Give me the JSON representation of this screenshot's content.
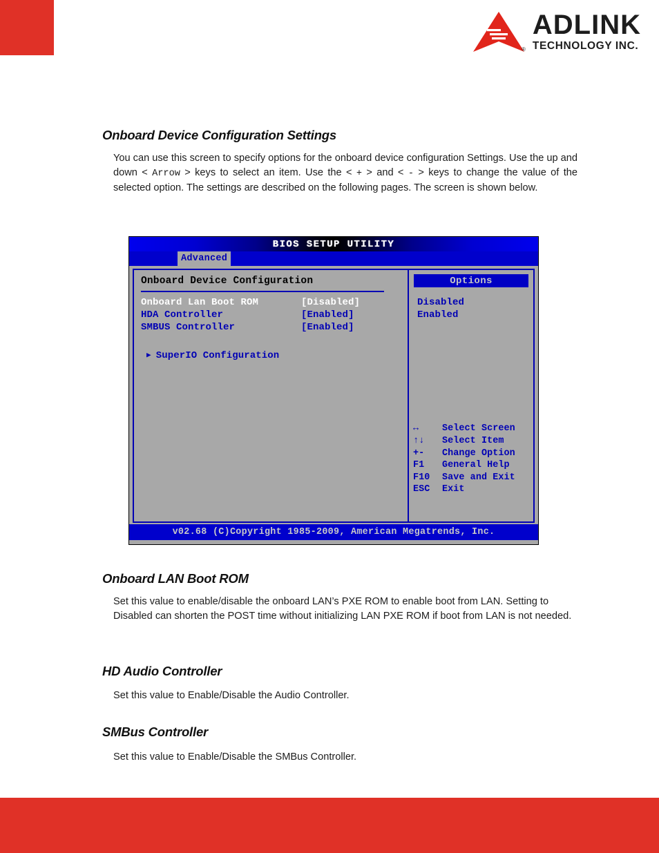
{
  "page": {
    "brand": {
      "name": "ADLINK",
      "tagline": "TECHNOLOGY INC.",
      "registered_mark": "®",
      "accent_color": "#e03127"
    }
  },
  "sections": [
    {
      "heading": "Onboard Device Configuration Settings",
      "paragraph_parts": {
        "p1": "You can use this screen to specify options for the onboard device configuration Settings. Use the up and down < ",
        "mono1": "Arrow",
        "p2": " > keys to select an item. Use the < ",
        "mono2": "+",
        "p3": " > and < ",
        "mono3": "-",
        "p4": " > keys to change the value of the selected option. The settings are described on the following pages. The screen is shown below."
      }
    },
    {
      "heading": "Onboard LAN Boot ROM",
      "body": "Set this value to enable/disable the onboard LAN’s PXE ROM to enable boot from LAN. Setting to Disabled can shorten the POST time without initializing LAN PXE ROM if boot from LAN is not needed."
    },
    {
      "heading": "HD Audio Controller",
      "body": "Set this value to Enable/Disable the Audio Controller."
    },
    {
      "heading": "SMBus Controller",
      "body": "Set this value to Enable/Disable the SMBus Controller."
    }
  ],
  "bios": {
    "title": "BIOS SETUP UTILITY",
    "tabs": [
      {
        "label": "Advanced",
        "selected": true
      }
    ],
    "panel_heading": "Onboard Device Configuration",
    "settings": [
      {
        "name": "Onboard Lan Boot ROM",
        "value": "[Disabled]",
        "selected": true
      },
      {
        "name": "HDA Controller",
        "value": "[Enabled]",
        "selected": false
      },
      {
        "name": "SMBUS Controller",
        "value": "[Enabled]",
        "selected": false
      }
    ],
    "submenu": {
      "arrow": "▶",
      "label": "SuperIO Configuration"
    },
    "options": {
      "header": "Options",
      "items": [
        "Disabled",
        "Enabled"
      ]
    },
    "key_help": [
      {
        "key": "↔",
        "desc": "Select Screen"
      },
      {
        "key": "↑↓",
        "desc": "Select Item"
      },
      {
        "key": "+-",
        "desc": "Change Option"
      },
      {
        "key": "F1",
        "desc": "General Help"
      },
      {
        "key": "F10",
        "desc": "Save and Exit"
      },
      {
        "key": "ESC",
        "desc": "Exit"
      }
    ],
    "footer": "v02.68 (C)Copyright 1985-2009, American Megatrends, Inc."
  }
}
